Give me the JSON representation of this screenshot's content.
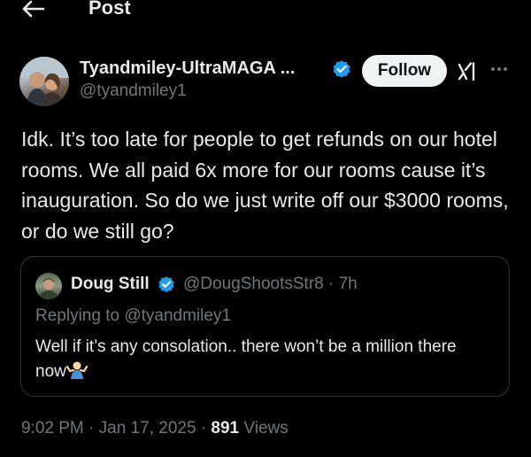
{
  "header": {
    "title": "Post",
    "back_icon": "arrow-left-icon"
  },
  "post": {
    "author_name": "Tyandmiley-UltraMAGA ...",
    "author_handle": "@tyandmiley1",
    "follow_label": "Follow",
    "text": "Idk. It’s too late for people to get refunds on our hotel rooms. We all paid 6x more for our rooms cause it’s inauguration. So do we just write off our $3000 rooms, or do we still go?",
    "time": "9:02 PM",
    "date": "Jan 17, 2025",
    "separator": "·",
    "views": "891",
    "views_label": "Views"
  },
  "quote": {
    "author_name": "Doug Still",
    "author_handle": "@DougShootsStr8",
    "separator": "·",
    "age": "7h",
    "replying_to": "Replying to @tyandmiley1",
    "text": "Well if it’s any consolation.. there won’t be a million there now"
  },
  "icons": {
    "verified": "verified-badge-icon",
    "grok": "grok-icon",
    "more": "more-options-icon",
    "emoji": "person-shrugging-emoji"
  },
  "colors": {
    "background": "#000000",
    "text_primary": "#e7e9ea",
    "text_secondary": "#71767b",
    "verified_blue": "#1d9bf0",
    "border": "#333639",
    "follow_bg": "#eff3f4"
  }
}
